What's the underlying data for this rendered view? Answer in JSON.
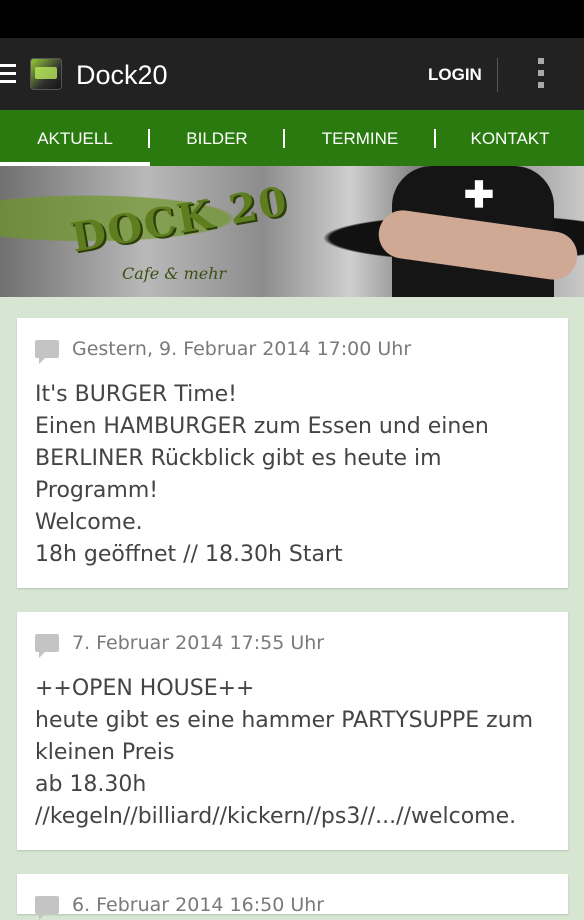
{
  "app": {
    "title": "Dock20",
    "login_label": "LOGIN"
  },
  "tabs": [
    {
      "label": "AKTUELL",
      "active": true
    },
    {
      "label": "BILDER"
    },
    {
      "label": "TERMINE"
    },
    {
      "label": "KONTAKT"
    }
  ],
  "banner": {
    "graffiti_text": "DOCK 20",
    "sub_text": "Cafe & mehr"
  },
  "posts": [
    {
      "date": "Gestern, 9. Februar 2014 17:00 Uhr",
      "lines": [
        "It's BURGER Time!",
        "Einen HAMBURGER zum Essen und einen",
        "BERLINER Rückblick gibt es heute im",
        "Programm!",
        "Welcome.",
        "18h geöffnet // 18.30h Start"
      ]
    },
    {
      "date": "7. Februar 2014 17:55 Uhr",
      "lines": [
        "++OPEN HOUSE++",
        "heute gibt es eine hammer PARTYSUPPE zum",
        "kleinen Preis",
        "ab 18.30h",
        "//kegeln//billiard//kickern//ps3//...//welcome."
      ]
    },
    {
      "date": "6. Februar 2014 16:50 Uhr",
      "lines": []
    }
  ],
  "colors": {
    "actionbar": "#222222",
    "tabbar": "#2a7a10",
    "background": "#d7e6d3"
  }
}
